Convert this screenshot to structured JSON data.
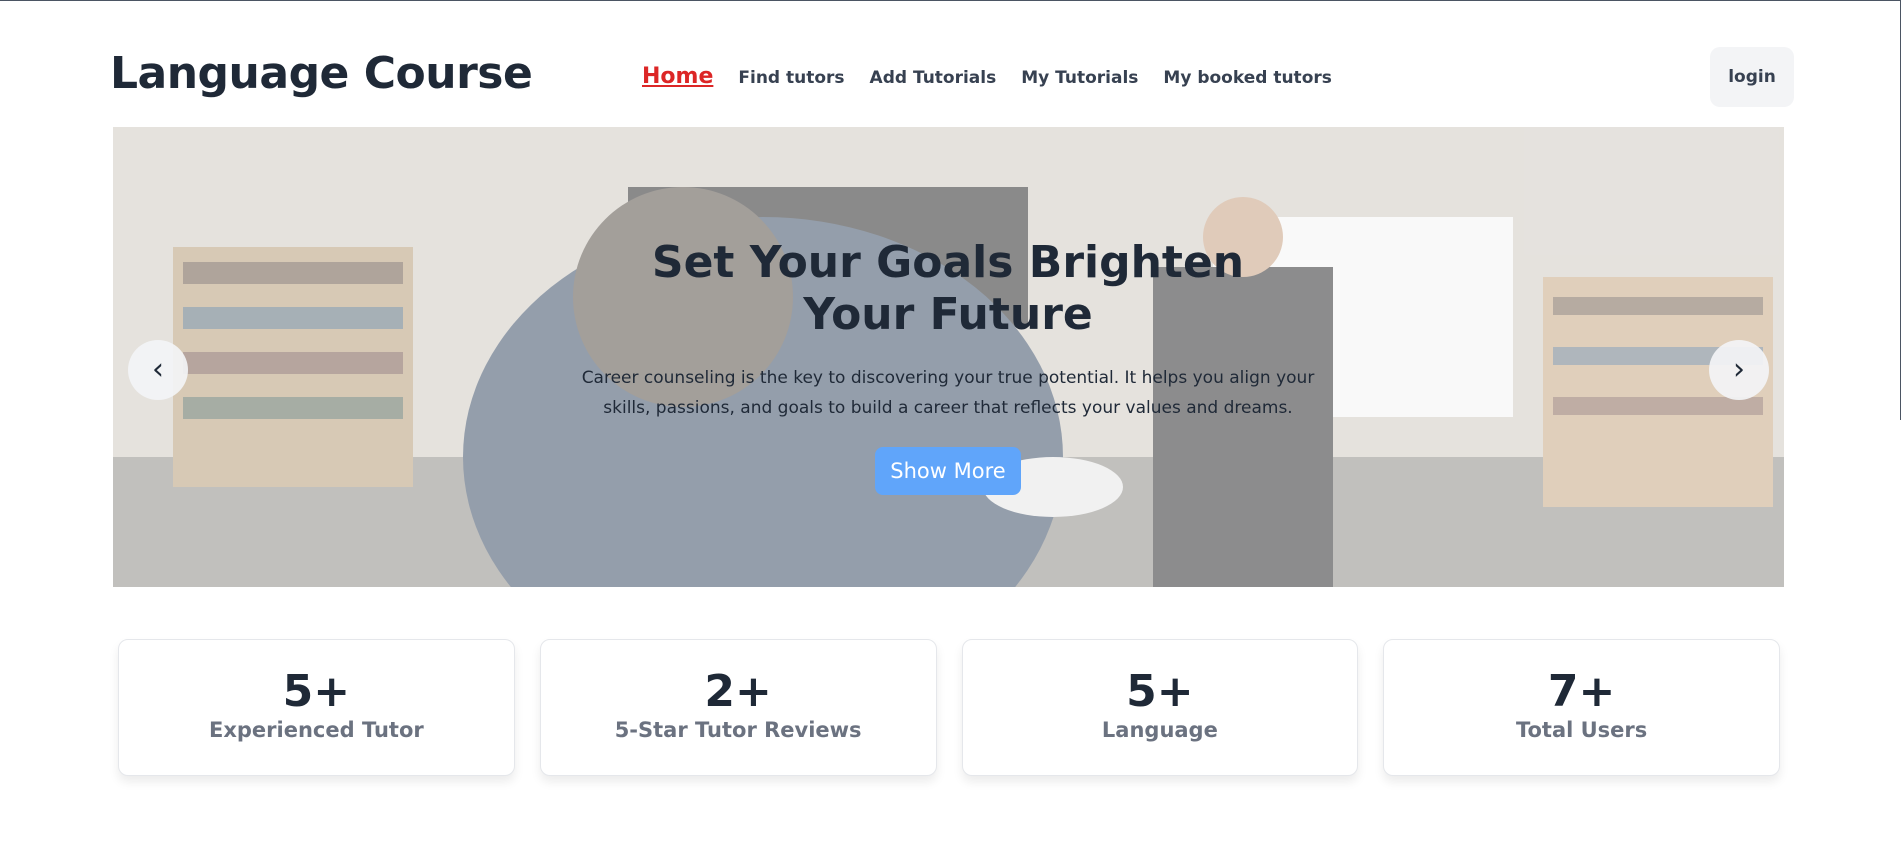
{
  "header": {
    "brand": "Language Course",
    "nav": [
      {
        "label": "Home",
        "active": true
      },
      {
        "label": "Find tutors",
        "active": false
      },
      {
        "label": "Add Tutorials",
        "active": false
      },
      {
        "label": "My Tutorials",
        "active": false
      },
      {
        "label": "My booked tutors",
        "active": false
      }
    ],
    "login_label": "login"
  },
  "hero": {
    "title": "Set Your Goals Brighten Your Future",
    "text": "Career counseling is the key to discovering your true potential. It helps you align your skills, passions, and goals to build a career that reflects your values and dreams.",
    "button_label": "Show More",
    "prev_icon": "‹",
    "next_icon": "›"
  },
  "stats": [
    {
      "value": "5+",
      "label": "Experienced Tutor"
    },
    {
      "value": "2+",
      "label": "5-Star Tutor Reviews"
    },
    {
      "value": "5+",
      "label": "Language"
    },
    {
      "value": "7+",
      "label": "Total Users"
    }
  ],
  "colors": {
    "active_nav": "#dc2626",
    "button": "#60a5fa",
    "text": "#1f2937",
    "muted": "#6b7280"
  }
}
